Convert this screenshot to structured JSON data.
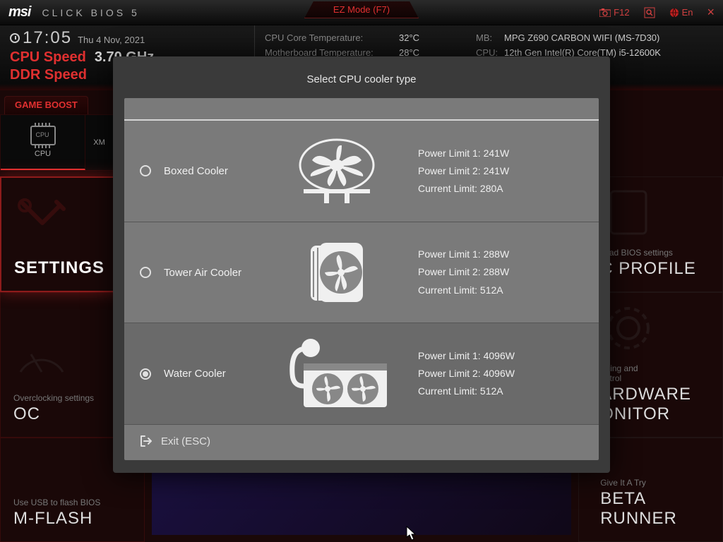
{
  "top": {
    "logo": "msi",
    "title": "CLICK BIOS 5",
    "ezmode": "EZ Mode (F7)",
    "f12": "F12",
    "lang": "En",
    "close": "×"
  },
  "clock": {
    "time": "17:05",
    "date": "Thu  4 Nov, 2021"
  },
  "speeds": {
    "cpu_label": "CPU Speed",
    "cpu_value": "3.70 GHz",
    "ddr_label": "DDR Speed"
  },
  "sysinfo": {
    "cputemp_lbl": "CPU Core Temperature:",
    "cputemp_val": "32°C",
    "mb_lbl": "MB:",
    "mb_val": "MPG Z690 CARBON WIFI (MS-7D30)",
    "mbtemp_lbl": "Motherboard Temperature:",
    "mbtemp_val": "28°C",
    "cpu_lbl": "CPU:",
    "cpu_val": "12th Gen Intel(R) Core(TM) i5-12600K"
  },
  "gameboost": "GAME BOOST",
  "chips": {
    "cpu": "CPU",
    "xmp": "XM"
  },
  "panels": {
    "settings": "SETTINGS",
    "oc_hint": "Overclocking settings",
    "oc": "OC",
    "mflash_hint": "Use USB to flash BIOS",
    "mflash": "M-FLASH",
    "ocprofile_hint": "/load BIOS settings",
    "ocprofile": "C PROFILE",
    "hwmon_hint": "toring and\nontrol",
    "hwmon": "ARDWARE\nONITOR",
    "beta_hint": "Give It A Try",
    "beta": "BETA RUNNER"
  },
  "modal": {
    "title": "Select CPU cooler type",
    "options": [
      {
        "label": "Boxed Cooler",
        "pl1": "Power Limit 1: 241W",
        "pl2": "Power Limit 2: 241W",
        "cl": "Current Limit: 280A",
        "selected": false
      },
      {
        "label": "Tower Air Cooler",
        "pl1": "Power Limit 1: 288W",
        "pl2": "Power Limit 2: 288W",
        "cl": "Current Limit: 512A",
        "selected": false
      },
      {
        "label": "Water Cooler",
        "pl1": "Power Limit 1: 4096W",
        "pl2": "Power Limit 2: 4096W",
        "cl": "Current Limit: 512A",
        "selected": true
      }
    ],
    "exit": "Exit (ESC)"
  }
}
